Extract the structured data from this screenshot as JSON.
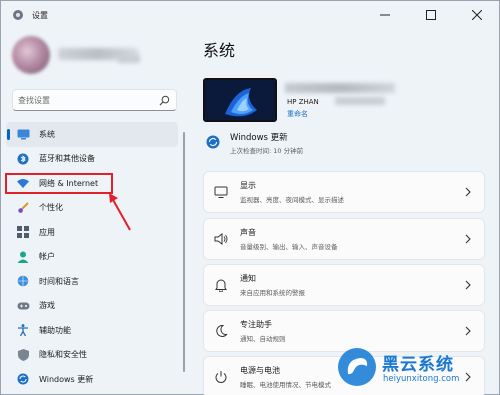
{
  "window": {
    "title": "设置",
    "controls": [
      "minimize",
      "maximize",
      "close"
    ]
  },
  "search": {
    "placeholder": "查找设置"
  },
  "sidebar": {
    "items": [
      {
        "label": "系统",
        "icon": "monitor-icon",
        "active": true
      },
      {
        "label": "蓝牙和其他设备",
        "icon": "bluetooth-icon"
      },
      {
        "label": "网络 & Internet",
        "icon": "wifi-icon"
      },
      {
        "label": "个性化",
        "icon": "brush-icon"
      },
      {
        "label": "应用",
        "icon": "apps-icon"
      },
      {
        "label": "帐户",
        "icon": "person-icon"
      },
      {
        "label": "时间和语言",
        "icon": "globe-clock-icon"
      },
      {
        "label": "游戏",
        "icon": "gamepad-icon"
      },
      {
        "label": "辅助功能",
        "icon": "accessibility-icon"
      },
      {
        "label": "隐私和安全性",
        "icon": "shield-icon"
      },
      {
        "label": "Windows 更新",
        "icon": "update-icon"
      }
    ]
  },
  "main": {
    "title": "系统",
    "device": {
      "name": "HP ZHAN",
      "rename": "重命名"
    },
    "update": {
      "title": "Windows 更新",
      "subtitle": "上次检查时间: 10 分钟前"
    },
    "cards": [
      {
        "title": "显示",
        "subtitle": "监视器、亮度、夜间模式、显示描述",
        "icon": "display-icon"
      },
      {
        "title": "声音",
        "subtitle": "音量级别、输出、输入、声音设备",
        "icon": "speaker-icon"
      },
      {
        "title": "通知",
        "subtitle": "来自应用和系统的警报",
        "icon": "bell-icon"
      },
      {
        "title": "专注助手",
        "subtitle": "通知、自动规则",
        "icon": "moon-icon"
      },
      {
        "title": "电源与电池",
        "subtitle": "睡眠、电池使用情况、节电模式",
        "icon": "power-icon"
      }
    ]
  },
  "watermark": {
    "title": "黑云系统",
    "url": "heiyunxitong.com"
  },
  "colors": {
    "accent": "#0067c0",
    "background": "#eef3f8",
    "annotation": "#e0202a"
  }
}
